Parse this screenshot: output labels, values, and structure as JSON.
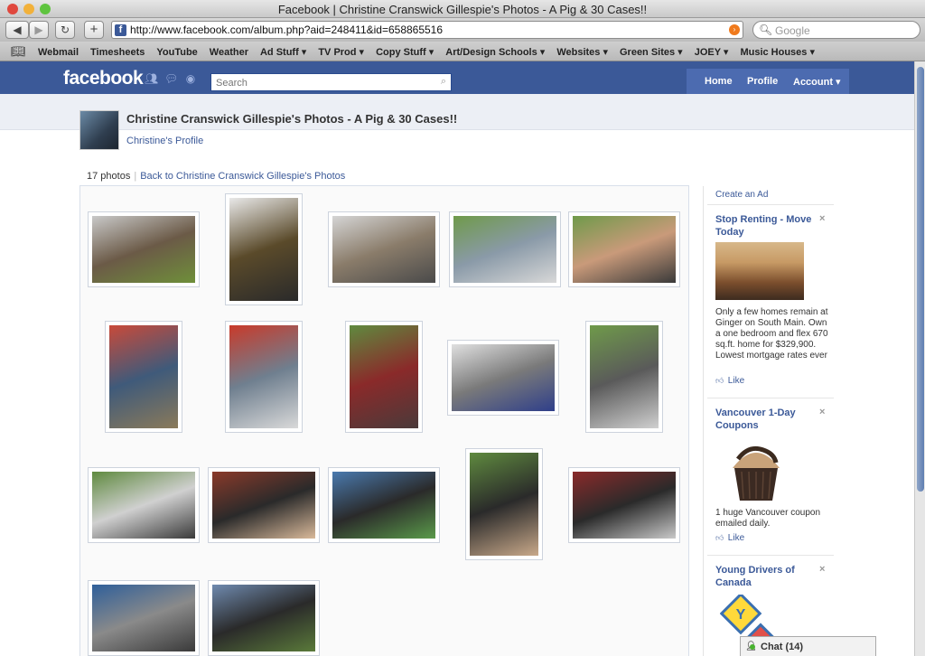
{
  "window": {
    "title": "Facebook | Christine Cranswick Gillespie's Photos - A Pig & 30 Cases!!"
  },
  "toolbar": {
    "back_icon": "back-arrow-icon",
    "forward_icon": "forward-arrow-icon",
    "reload_icon": "reload-icon",
    "add_icon": "plus-icon",
    "url": "http://www.facebook.com/album.php?aid=248411&id=658865516",
    "search_placeholder": "Google"
  },
  "bookmarks": [
    "Webmail",
    "Timesheets",
    "YouTube",
    "Weather",
    "Ad Stuff ▾",
    "TV Prod ▾",
    "Copy Stuff ▾",
    "Art/Design Schools ▾",
    "Websites ▾",
    "Green Sites ▾",
    "JOEY ▾",
    "Music Houses ▾"
  ],
  "fb": {
    "logo": "facebook",
    "search_placeholder": "Search",
    "nav": {
      "home": "Home",
      "profile": "Profile",
      "account": "Account ▾"
    }
  },
  "album": {
    "title": "Christine Cranswick Gillespie's Photos - A Pig & 30 Cases!!",
    "profile_link": "Christine's Profile",
    "count": "17 photos",
    "back_link": "Back to Christine Cranswick Gillespie's Photos"
  },
  "photos": [
    {
      "desc": "grill",
      "colors": [
        "#c9c9c9",
        "#6b5a47",
        "#6f8f3a"
      ]
    },
    {
      "desc": "fridge",
      "colors": [
        "#e9e9e9",
        "#5a4a2a",
        "#2a2a2a"
      ]
    },
    {
      "desc": "bbq-man",
      "colors": [
        "#d5d5d5",
        "#8a7c6a",
        "#4a4a4a"
      ]
    },
    {
      "desc": "couch-guy",
      "colors": [
        "#6f9a4a",
        "#8a9aa8",
        "#d8d8d8"
      ]
    },
    {
      "desc": "couple",
      "colors": [
        "#6f9a4a",
        "#c99a7a",
        "#3a3a3a"
      ]
    },
    {
      "desc": "fridge-people",
      "colors": [
        "#c94a3a",
        "#3f5a7a",
        "#8a7a5a"
      ]
    },
    {
      "desc": "tv-couch",
      "colors": [
        "#c93a2a",
        "#6f7f8f",
        "#d9d9d9"
      ]
    },
    {
      "desc": "chair-woman",
      "colors": [
        "#5f8a3f",
        "#8a2a2a",
        "#4a3a3a"
      ]
    },
    {
      "desc": "wide-room",
      "colors": [
        "#e0e0e0",
        "#7a7a7a",
        "#2f3f8a"
      ]
    },
    {
      "desc": "cheer",
      "colors": [
        "#6f9a4a",
        "#5a5a5a",
        "#d0d0d0"
      ]
    },
    {
      "desc": "yard-group",
      "colors": [
        "#5f8a3f",
        "#d0d0d0",
        "#3a3a3a"
      ]
    },
    {
      "desc": "two-guys",
      "colors": [
        "#8a3a2a",
        "#2a2a2a",
        "#d9b99a"
      ]
    },
    {
      "desc": "tent-group",
      "colors": [
        "#4a7aaf",
        "#2a2a2a",
        "#5a9a4a"
      ]
    },
    {
      "desc": "dance",
      "colors": [
        "#5f8a3f",
        "#2a2a2a",
        "#c9a98a"
      ]
    },
    {
      "desc": "smiling-girl",
      "colors": [
        "#8a2a2a",
        "#2a2a2a",
        "#c9c9c9"
      ]
    },
    {
      "desc": "arms-up",
      "colors": [
        "#2f5f9a",
        "#8a8a8a",
        "#3a3a3a"
      ]
    },
    {
      "desc": "party",
      "colors": [
        "#6f8aaf",
        "#2a2a2a",
        "#5a7a3a"
      ]
    }
  ],
  "ads": {
    "create": "Create an Ad",
    "items": [
      {
        "title": "Stop Renting - Move Today",
        "body": "Only a few homes remain at Ginger on South Main. Own a one bedroom and flex 670 sq.ft. home for $329,900. Lowest mortgage rates ever",
        "like": "Like",
        "close": "×"
      },
      {
        "title": "Vancouver 1-Day Coupons",
        "body": "1 huge Vancouver coupon emailed daily.",
        "like": "Like",
        "close": "×"
      },
      {
        "title": "Young Drivers of Canada",
        "close": "×",
        "badge": "Y"
      }
    ]
  },
  "chat": {
    "label": "Chat",
    "count": "(14)"
  }
}
